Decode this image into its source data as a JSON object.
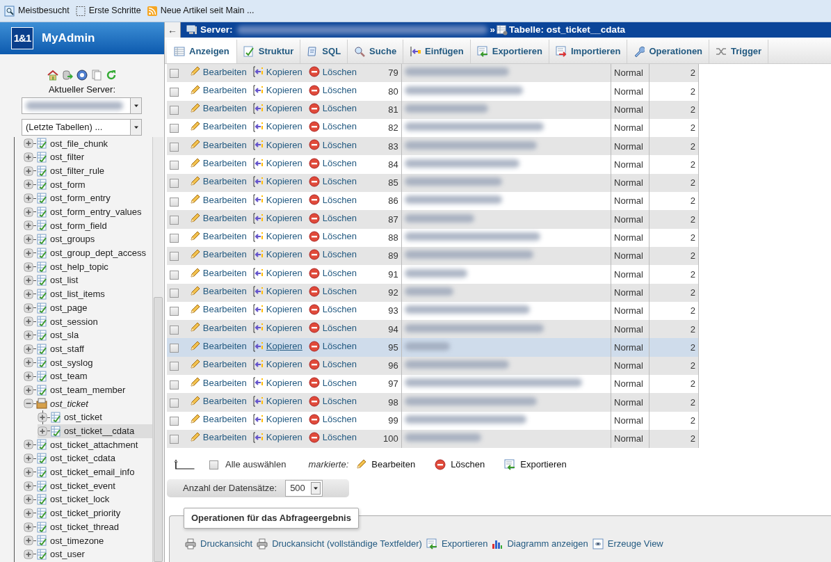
{
  "bookmarks": [
    {
      "label": "Meistbesucht"
    },
    {
      "label": "Erste Schritte"
    },
    {
      "label": "Neue Artikel seit Main ..."
    }
  ],
  "sidebar": {
    "logo": "1&1",
    "brand": "MyAdmin",
    "server_label": "Aktueller Server:",
    "recent_tables": "(Letzte Tabellen) ...",
    "tree": [
      {
        "label": "ost_file_chunk",
        "kind": "table",
        "expanded": false,
        "selected": false
      },
      {
        "label": "ost_filter",
        "kind": "table",
        "expanded": false,
        "selected": false
      },
      {
        "label": "ost_filter_rule",
        "kind": "table",
        "expanded": false,
        "selected": false
      },
      {
        "label": "ost_form",
        "kind": "table",
        "expanded": false,
        "selected": false
      },
      {
        "label": "ost_form_entry",
        "kind": "table",
        "expanded": false,
        "selected": false
      },
      {
        "label": "ost_form_entry_values",
        "kind": "table",
        "expanded": false,
        "selected": false
      },
      {
        "label": "ost_form_field",
        "kind": "table",
        "expanded": false,
        "selected": false
      },
      {
        "label": "ost_groups",
        "kind": "table",
        "expanded": false,
        "selected": false
      },
      {
        "label": "ost_group_dept_access",
        "kind": "table",
        "expanded": false,
        "selected": false
      },
      {
        "label": "ost_help_topic",
        "kind": "table",
        "expanded": false,
        "selected": false
      },
      {
        "label": "ost_list",
        "kind": "table",
        "expanded": false,
        "selected": false
      },
      {
        "label": "ost_list_items",
        "kind": "table",
        "expanded": false,
        "selected": false
      },
      {
        "label": "ost_page",
        "kind": "table",
        "expanded": false,
        "selected": false
      },
      {
        "label": "ost_session",
        "kind": "table",
        "expanded": false,
        "selected": false
      },
      {
        "label": "ost_sla",
        "kind": "table",
        "expanded": false,
        "selected": false
      },
      {
        "label": "ost_staff",
        "kind": "table",
        "expanded": false,
        "selected": false
      },
      {
        "label": "ost_syslog",
        "kind": "table",
        "expanded": false,
        "selected": false
      },
      {
        "label": "ost_team",
        "kind": "table",
        "expanded": false,
        "selected": false
      },
      {
        "label": "ost_team_member",
        "kind": "table",
        "expanded": false,
        "selected": false
      },
      {
        "label": "ost_ticket",
        "kind": "group",
        "expanded": true,
        "selected": false,
        "children": [
          {
            "label": "ost_ticket",
            "kind": "table",
            "expanded": false,
            "selected": false
          },
          {
            "label": "ost_ticket__cdata",
            "kind": "table",
            "expanded": false,
            "selected": true
          }
        ]
      },
      {
        "label": "ost_ticket_attachment",
        "kind": "table",
        "expanded": false,
        "selected": false
      },
      {
        "label": "ost_ticket_cdata",
        "kind": "table",
        "expanded": false,
        "selected": false
      },
      {
        "label": "ost_ticket_email_info",
        "kind": "table",
        "expanded": false,
        "selected": false
      },
      {
        "label": "ost_ticket_event",
        "kind": "table",
        "expanded": false,
        "selected": false
      },
      {
        "label": "ost_ticket_lock",
        "kind": "table",
        "expanded": false,
        "selected": false
      },
      {
        "label": "ost_ticket_priority",
        "kind": "table",
        "expanded": false,
        "selected": false
      },
      {
        "label": "ost_ticket_thread",
        "kind": "table",
        "expanded": false,
        "selected": false
      },
      {
        "label": "ost_timezone",
        "kind": "table",
        "expanded": false,
        "selected": false
      },
      {
        "label": "ost_user",
        "kind": "table",
        "expanded": false,
        "selected": false
      }
    ]
  },
  "breadcrumb": {
    "back": "←",
    "server_label": "Server:",
    "separator": "»",
    "table_label": "Tabelle: ost_ticket__cdata"
  },
  "tabs": [
    {
      "label": "Anzeigen",
      "selected": true
    },
    {
      "label": "Struktur",
      "selected": false
    },
    {
      "label": "SQL",
      "selected": false
    },
    {
      "label": "Suche",
      "selected": false
    },
    {
      "label": "Einfügen",
      "selected": false
    },
    {
      "label": "Exportieren",
      "selected": false
    },
    {
      "label": "Importieren",
      "selected": false
    },
    {
      "label": "Operationen",
      "selected": false
    },
    {
      "label": "Trigger",
      "selected": false
    }
  ],
  "rows": [
    {
      "edit": "Bearbeiten",
      "copy": "Kopieren",
      "delete": "Löschen",
      "id": "79",
      "status": "Normal",
      "column_7": "2",
      "checked": false,
      "selected": false
    },
    {
      "edit": "Bearbeiten",
      "copy": "Kopieren",
      "delete": "Löschen",
      "id": "80",
      "status": "Normal",
      "column_7": "2",
      "checked": false,
      "selected": false
    },
    {
      "edit": "Bearbeiten",
      "copy": "Kopieren",
      "delete": "Löschen",
      "id": "81",
      "status": "Normal",
      "column_7": "2",
      "checked": false,
      "selected": false
    },
    {
      "edit": "Bearbeiten",
      "copy": "Kopieren",
      "delete": "Löschen",
      "id": "82",
      "status": "Normal",
      "column_7": "2",
      "checked": false,
      "selected": false
    },
    {
      "edit": "Bearbeiten",
      "copy": "Kopieren",
      "delete": "Löschen",
      "id": "83",
      "status": "Normal",
      "column_7": "2",
      "checked": false,
      "selected": false
    },
    {
      "edit": "Bearbeiten",
      "copy": "Kopieren",
      "delete": "Löschen",
      "id": "84",
      "status": "Normal",
      "column_7": "2",
      "checked": false,
      "selected": false
    },
    {
      "edit": "Bearbeiten",
      "copy": "Kopieren",
      "delete": "Löschen",
      "id": "85",
      "status": "Normal",
      "column_7": "2",
      "checked": false,
      "selected": false
    },
    {
      "edit": "Bearbeiten",
      "copy": "Kopieren",
      "delete": "Löschen",
      "id": "86",
      "status": "Normal",
      "column_7": "2",
      "checked": false,
      "selected": false
    },
    {
      "edit": "Bearbeiten",
      "copy": "Kopieren",
      "delete": "Löschen",
      "id": "87",
      "status": "Normal",
      "column_7": "2",
      "checked": false,
      "selected": false
    },
    {
      "edit": "Bearbeiten",
      "copy": "Kopieren",
      "delete": "Löschen",
      "id": "88",
      "status": "Normal",
      "column_7": "2",
      "checked": false,
      "selected": false
    },
    {
      "edit": "Bearbeiten",
      "copy": "Kopieren",
      "delete": "Löschen",
      "id": "89",
      "status": "Normal",
      "column_7": "2",
      "checked": false,
      "selected": false
    },
    {
      "edit": "Bearbeiten",
      "copy": "Kopieren",
      "delete": "Löschen",
      "id": "91",
      "status": "Normal",
      "column_7": "2",
      "checked": false,
      "selected": false
    },
    {
      "edit": "Bearbeiten",
      "copy": "Kopieren",
      "delete": "Löschen",
      "id": "92",
      "status": "Normal",
      "column_7": "2",
      "checked": false,
      "selected": false
    },
    {
      "edit": "Bearbeiten",
      "copy": "Kopieren",
      "delete": "Löschen",
      "id": "93",
      "status": "Normal",
      "column_7": "2",
      "checked": false,
      "selected": false
    },
    {
      "edit": "Bearbeiten",
      "copy": "Kopieren",
      "delete": "Löschen",
      "id": "94",
      "status": "Normal",
      "column_7": "2",
      "checked": false,
      "selected": false
    },
    {
      "edit": "Bearbeiten",
      "copy": "Kopieren",
      "delete": "Löschen",
      "id": "95",
      "status": "Normal",
      "column_7": "2",
      "checked": false,
      "selected": true
    },
    {
      "edit": "Bearbeiten",
      "copy": "Kopieren",
      "delete": "Löschen",
      "id": "96",
      "status": "Normal",
      "column_7": "2",
      "checked": false,
      "selected": false
    },
    {
      "edit": "Bearbeiten",
      "copy": "Kopieren",
      "delete": "Löschen",
      "id": "97",
      "status": "Normal",
      "column_7": "2",
      "checked": false,
      "selected": false
    },
    {
      "edit": "Bearbeiten",
      "copy": "Kopieren",
      "delete": "Löschen",
      "id": "98",
      "status": "Normal",
      "column_7": "2",
      "checked": false,
      "selected": false
    },
    {
      "edit": "Bearbeiten",
      "copy": "Kopieren",
      "delete": "Löschen",
      "id": "99",
      "status": "Normal",
      "column_7": "2",
      "checked": false,
      "selected": false
    },
    {
      "edit": "Bearbeiten",
      "copy": "Kopieren",
      "delete": "Löschen",
      "id": "100",
      "status": "Normal",
      "column_7": "2",
      "checked": false,
      "selected": false
    }
  ],
  "bulk": {
    "check_all": "Alle auswählen",
    "checked": false,
    "with_selected": "markierte:",
    "actions": [
      "Bearbeiten",
      "Löschen",
      "Exportieren"
    ]
  },
  "records": {
    "label": "Anzahl der Datensätze:",
    "value": "500"
  },
  "operations": {
    "legend": "Operationen für das Abfrageergebnis",
    "links": [
      "Druckansicht",
      "Druckansicht (vollständige Textfelder)",
      "Exportieren",
      "Diagramm anzeigen",
      "Erzeuge View"
    ]
  }
}
